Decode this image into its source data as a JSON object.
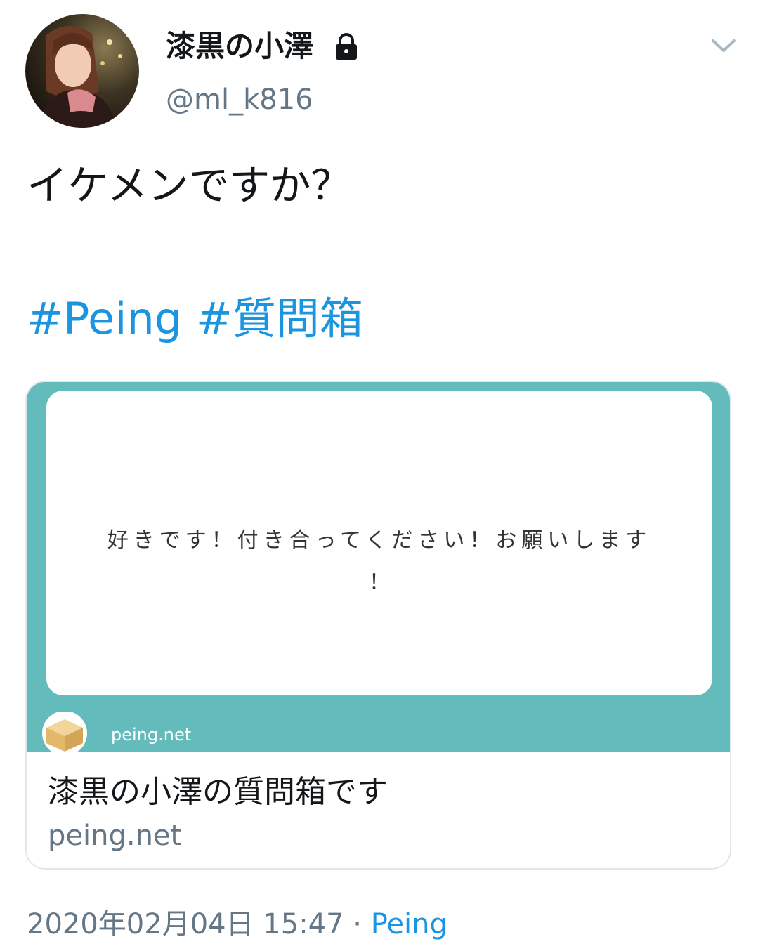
{
  "user": {
    "display_name": "漆黒の小澤",
    "handle": "@ml_k816"
  },
  "tweet": {
    "text": "イケメンですか？",
    "hashtags": [
      "#Peing",
      "#質問箱"
    ]
  },
  "card": {
    "question_line1": "好きです！付き合ってください！お願いします",
    "question_line2": "！",
    "image_domain": "peing.net",
    "title": "漆黒の小澤の質問箱です",
    "url": "peing.net"
  },
  "meta": {
    "timestamp": "2020年02月04日 15:47",
    "separator": " · ",
    "source": "Peing"
  },
  "colors": {
    "link": "#1b95e0",
    "secondary_text": "#657786",
    "card_teal": "#63bcbb"
  },
  "icons": [
    "avatar",
    "lock-icon",
    "chevron-down-icon",
    "peing-box-logo"
  ]
}
